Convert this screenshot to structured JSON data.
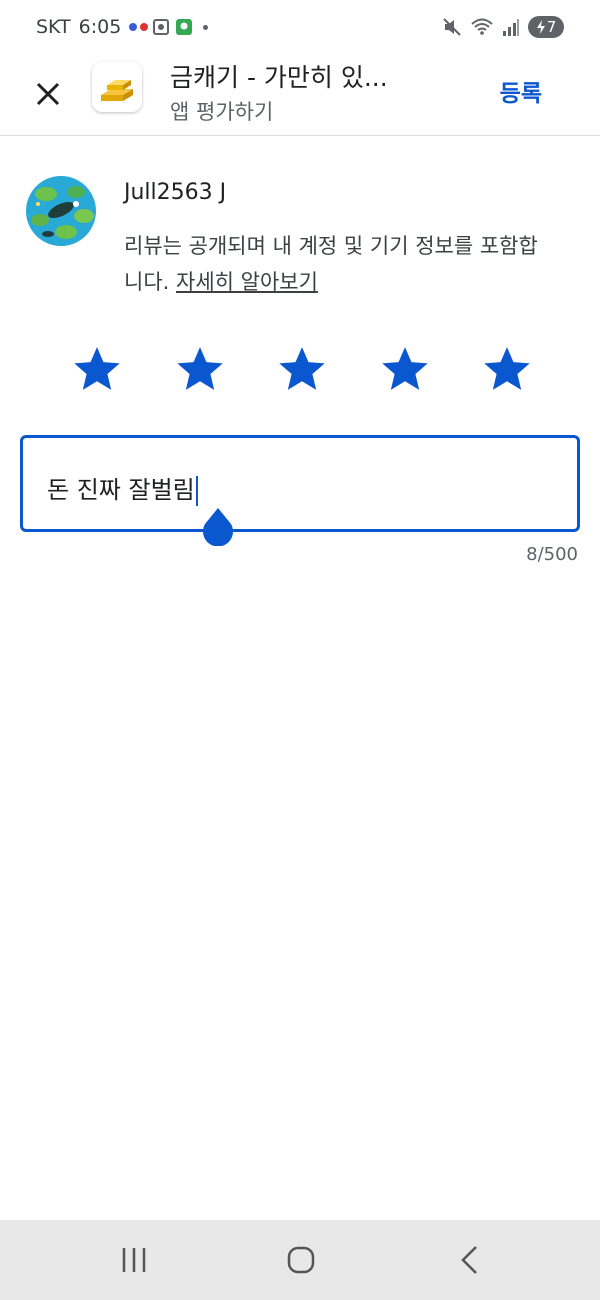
{
  "status_bar": {
    "carrier": "SKT",
    "time": "6:05",
    "battery": "7"
  },
  "header": {
    "app_title": "금캐기 - 가만히 있...",
    "subtitle": "앱 평가하기",
    "submit_label": "등록"
  },
  "user": {
    "name": "Jull2563 J"
  },
  "notice": {
    "text": "리뷰는 공개되며 내 계정 및 기기 정보를 포함합니다. ",
    "link": "자세히 알아보기"
  },
  "rating": {
    "value": 5,
    "max": 5
  },
  "review": {
    "text": "돈 진짜 잘벌림",
    "char_count": "8/500"
  },
  "colors": {
    "accent": "#0b57d0"
  },
  "icons": {
    "close": "close-icon",
    "star": "star-icon",
    "nav_recent": "recent-apps-icon",
    "nav_home": "home-icon",
    "nav_back": "back-icon"
  }
}
